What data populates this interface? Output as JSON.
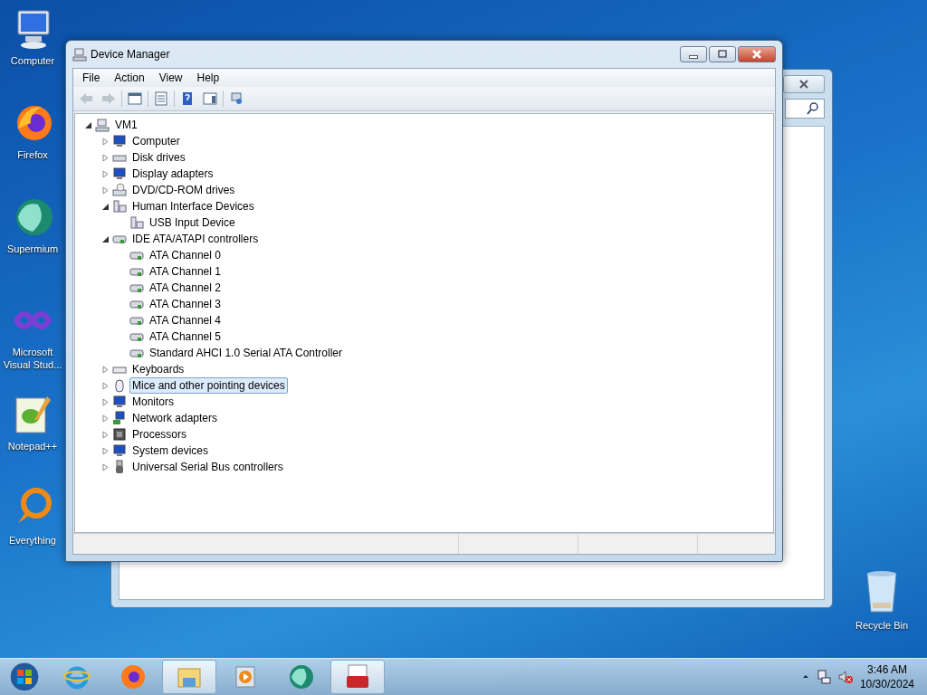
{
  "desktop_icons": [
    {
      "label": "Computer",
      "kind": "computer"
    },
    {
      "label": "Firefox",
      "kind": "firefox"
    },
    {
      "label": "Supermium",
      "kind": "supermium"
    },
    {
      "label": "Microsoft Visual Stud...",
      "kind": "vs"
    },
    {
      "label": "Notepad++",
      "kind": "notepad"
    },
    {
      "label": "Everything",
      "kind": "everything"
    }
  ],
  "recycle_bin": {
    "label": "Recycle Bin"
  },
  "window": {
    "title": "Device Manager",
    "menu": [
      "File",
      "Action",
      "View",
      "Help"
    ],
    "toolbar": [
      {
        "kind": "back",
        "disabled": true
      },
      {
        "kind": "forward",
        "disabled": true
      },
      {
        "kind": "sep"
      },
      {
        "kind": "tree",
        "disabled": false
      },
      {
        "kind": "sep"
      },
      {
        "kind": "properties",
        "disabled": false
      },
      {
        "kind": "sep"
      },
      {
        "kind": "help",
        "disabled": false
      },
      {
        "kind": "pane",
        "disabled": false
      },
      {
        "kind": "sep"
      },
      {
        "kind": "scan",
        "disabled": false
      }
    ],
    "tree": {
      "label": "VM1",
      "kind": "host",
      "expanded": true,
      "selected": false,
      "children": [
        {
          "label": "Computer",
          "kind": "monitor",
          "expanded": false,
          "selected": false
        },
        {
          "label": "Disk drives",
          "kind": "drive",
          "expanded": false,
          "selected": false
        },
        {
          "label": "Display adapters",
          "kind": "monitor",
          "expanded": false,
          "selected": false
        },
        {
          "label": "DVD/CD-ROM drives",
          "kind": "dvd",
          "expanded": false,
          "selected": false
        },
        {
          "label": "Human Interface Devices",
          "kind": "hid",
          "expanded": true,
          "selected": false,
          "children": [
            {
              "label": "USB Input Device",
              "kind": "hid",
              "selected": false
            }
          ]
        },
        {
          "label": "IDE ATA/ATAPI controllers",
          "kind": "controller",
          "expanded": true,
          "selected": false,
          "children": [
            {
              "label": "ATA Channel 0",
              "kind": "controller",
              "selected": false
            },
            {
              "label": "ATA Channel 1",
              "kind": "controller",
              "selected": false
            },
            {
              "label": "ATA Channel 2",
              "kind": "controller",
              "selected": false
            },
            {
              "label": "ATA Channel 3",
              "kind": "controller",
              "selected": false
            },
            {
              "label": "ATA Channel 4",
              "kind": "controller",
              "selected": false
            },
            {
              "label": "ATA Channel 5",
              "kind": "controller",
              "selected": false
            },
            {
              "label": "Standard AHCI 1.0 Serial ATA Controller",
              "kind": "controller",
              "selected": false
            }
          ]
        },
        {
          "label": "Keyboards",
          "kind": "keyboard",
          "expanded": false,
          "selected": false
        },
        {
          "label": "Mice and other pointing devices",
          "kind": "mouse",
          "expanded": false,
          "selected": true
        },
        {
          "label": "Monitors",
          "kind": "monitor",
          "expanded": false,
          "selected": false
        },
        {
          "label": "Network adapters",
          "kind": "network",
          "expanded": false,
          "selected": false
        },
        {
          "label": "Processors",
          "kind": "chip",
          "expanded": false,
          "selected": false
        },
        {
          "label": "System devices",
          "kind": "monitor",
          "expanded": false,
          "selected": false
        },
        {
          "label": "Universal Serial Bus controllers",
          "kind": "usb",
          "expanded": false,
          "selected": false
        }
      ]
    }
  },
  "taskbar": {
    "items": [
      {
        "kind": "ie",
        "open": false
      },
      {
        "kind": "firefox",
        "open": false
      },
      {
        "kind": "explorer",
        "open": true
      },
      {
        "kind": "media",
        "open": false
      },
      {
        "kind": "supermium",
        "open": false
      },
      {
        "kind": "toolbox",
        "open": true
      }
    ],
    "clock": {
      "time": "3:46 AM",
      "date": "10/30/2024"
    }
  }
}
